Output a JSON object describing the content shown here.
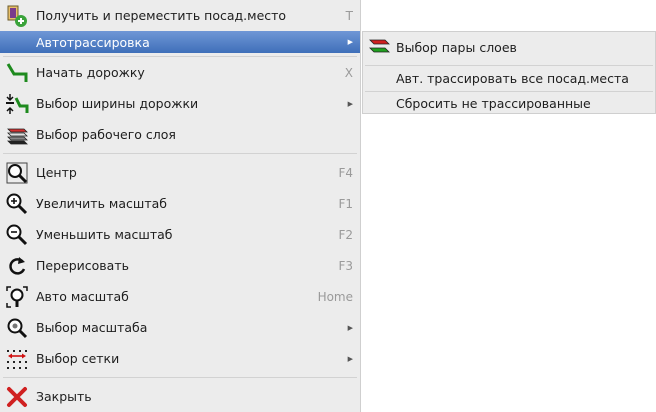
{
  "menu": {
    "items": [
      {
        "label": "Получить и переместить посад.место",
        "shortcut": "T",
        "icon": "footprint-move-icon"
      },
      {
        "label": "Автотрассировка",
        "icon": "none",
        "has_submenu": true,
        "highlighted": true
      },
      {
        "label": "Начать дорожку",
        "shortcut": "X",
        "icon": "route-track-icon"
      },
      {
        "label": "Выбор ширины дорожки",
        "icon": "track-width-icon",
        "has_submenu": true
      },
      {
        "label": "Выбор рабочего слоя",
        "icon": "layers-icon"
      },
      {
        "label": "Центр",
        "shortcut": "F4",
        "icon": "zoom-center-icon"
      },
      {
        "label": "Увеличить масштаб",
        "shortcut": "F1",
        "icon": "zoom-in-icon"
      },
      {
        "label": "Уменьшить масштаб",
        "shortcut": "F2",
        "icon": "zoom-out-icon"
      },
      {
        "label": "Перерисовать",
        "shortcut": "F3",
        "icon": "redraw-icon"
      },
      {
        "label": "Авто масштаб",
        "shortcut": "Home",
        "icon": "zoom-fit-icon"
      },
      {
        "label": "Выбор масштаба",
        "icon": "zoom-select-icon",
        "has_submenu": true
      },
      {
        "label": "Выбор сетки",
        "icon": "grid-icon",
        "has_submenu": true
      },
      {
        "label": "Закрыть",
        "icon": "close-icon"
      }
    ]
  },
  "submenu": {
    "items": [
      {
        "label": "Выбор пары слоев",
        "icon": "layer-pair-icon"
      },
      {
        "label": "Авт. трассировать все посад.места"
      },
      {
        "label": "Сбросить не трассированные"
      }
    ]
  },
  "colors": {
    "highlight": "#4f7ec4",
    "menu_bg": "#ececec",
    "shortcut": "#9a9a9a"
  }
}
